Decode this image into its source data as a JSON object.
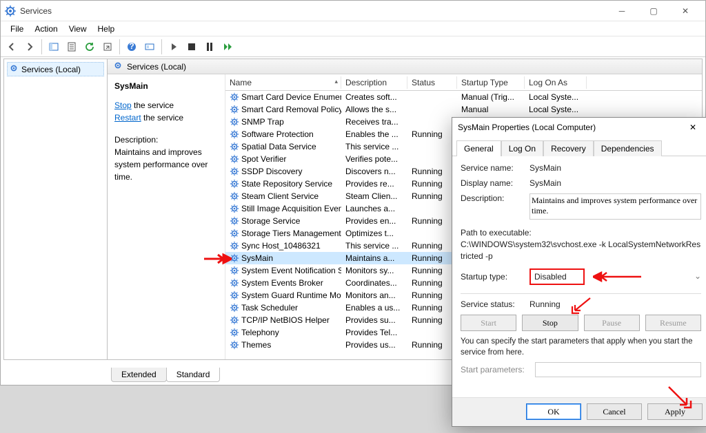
{
  "window": {
    "title": "Services",
    "menus": [
      "File",
      "Action",
      "View",
      "Help"
    ]
  },
  "leftpane": {
    "node": "Services (Local)"
  },
  "header_label": "Services (Local)",
  "detail": {
    "service_name": "SysMain",
    "stop_label": "Stop",
    "stop_suffix": " the service",
    "restart_label": "Restart",
    "restart_suffix": " the service",
    "desc_label": "Description:",
    "desc_text": "Maintains and improves system performance over time."
  },
  "columns": [
    "Name",
    "Description",
    "Status",
    "Startup Type",
    "Log On As"
  ],
  "rows": [
    {
      "name": "Smart Card Device Enumera...",
      "desc": "Creates soft...",
      "status": "",
      "startup": "Manual (Trig...",
      "logon": "Local Syste..."
    },
    {
      "name": "Smart Card Removal Policy",
      "desc": "Allows the s...",
      "status": "",
      "startup": "Manual",
      "logon": "Local Syste..."
    },
    {
      "name": "SNMP Trap",
      "desc": "Receives tra...",
      "status": "",
      "startup": "",
      "logon": ""
    },
    {
      "name": "Software Protection",
      "desc": "Enables the ...",
      "status": "Running",
      "startup": "",
      "logon": ""
    },
    {
      "name": "Spatial Data Service",
      "desc": "This service ...",
      "status": "",
      "startup": "",
      "logon": ""
    },
    {
      "name": "Spot Verifier",
      "desc": "Verifies pote...",
      "status": "",
      "startup": "",
      "logon": ""
    },
    {
      "name": "SSDP Discovery",
      "desc": "Discovers n...",
      "status": "Running",
      "startup": "",
      "logon": ""
    },
    {
      "name": "State Repository Service",
      "desc": "Provides re...",
      "status": "Running",
      "startup": "",
      "logon": ""
    },
    {
      "name": "Steam Client Service",
      "desc": "Steam Clien...",
      "status": "Running",
      "startup": "",
      "logon": ""
    },
    {
      "name": "Still Image Acquisition Events",
      "desc": "Launches a...",
      "status": "",
      "startup": "",
      "logon": ""
    },
    {
      "name": "Storage Service",
      "desc": "Provides en...",
      "status": "Running",
      "startup": "",
      "logon": ""
    },
    {
      "name": "Storage Tiers Management",
      "desc": "Optimizes t...",
      "status": "",
      "startup": "",
      "logon": ""
    },
    {
      "name": "Sync Host_10486321",
      "desc": "This service ...",
      "status": "Running",
      "startup": "",
      "logon": ""
    },
    {
      "name": "SysMain",
      "desc": "Maintains a...",
      "status": "Running",
      "startup": "",
      "logon": "",
      "selected": true
    },
    {
      "name": "System Event Notification S...",
      "desc": "Monitors sy...",
      "status": "Running",
      "startup": "",
      "logon": ""
    },
    {
      "name": "System Events Broker",
      "desc": "Coordinates...",
      "status": "Running",
      "startup": "",
      "logon": ""
    },
    {
      "name": "System Guard Runtime Mo...",
      "desc": "Monitors an...",
      "status": "Running",
      "startup": "",
      "logon": ""
    },
    {
      "name": "Task Scheduler",
      "desc": "Enables a us...",
      "status": "Running",
      "startup": "",
      "logon": ""
    },
    {
      "name": "TCP/IP NetBIOS Helper",
      "desc": "Provides su...",
      "status": "Running",
      "startup": "",
      "logon": ""
    },
    {
      "name": "Telephony",
      "desc": "Provides Tel...",
      "status": "",
      "startup": "",
      "logon": ""
    },
    {
      "name": "Themes",
      "desc": "Provides us...",
      "status": "Running",
      "startup": "",
      "logon": ""
    }
  ],
  "bottom_tabs": {
    "extended": "Extended",
    "standard": "Standard"
  },
  "dialog": {
    "title": "SysMain Properties (Local Computer)",
    "tabs": [
      "General",
      "Log On",
      "Recovery",
      "Dependencies"
    ],
    "service_name_label": "Service name:",
    "service_name": "SysMain",
    "display_name_label": "Display name:",
    "display_name": "SysMain",
    "description_label": "Description:",
    "description": "Maintains and improves system performance over time.",
    "path_label": "Path to executable:",
    "path_value": "C:\\WINDOWS\\system32\\svchost.exe -k LocalSystemNetworkRestricted -p",
    "startup_type_label": "Startup type:",
    "startup_type_value": "Disabled",
    "service_status_label": "Service status:",
    "service_status_value": "Running",
    "btn_start": "Start",
    "btn_stop": "Stop",
    "btn_pause": "Pause",
    "btn_resume": "Resume",
    "note": "You can specify the start parameters that apply when you start the service from here.",
    "start_params_label": "Start parameters:",
    "btn_ok": "OK",
    "btn_cancel": "Cancel",
    "btn_apply": "Apply"
  },
  "watermark": ""
}
